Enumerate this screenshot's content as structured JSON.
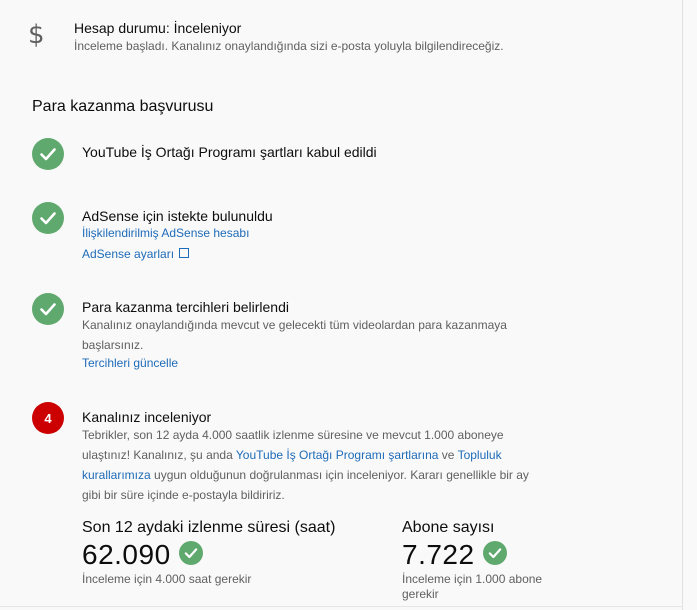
{
  "status": {
    "icon": "dollar-icon",
    "title": "Hesap durumu: İnceleniyor",
    "description": "İnceleme başladı. Kanalınız onaylandığında sizi e-posta yoluyla bilgilendireceğiz."
  },
  "monetization": {
    "title": "Para kazanma başvurusu",
    "steps": [
      {
        "state": "done",
        "title": "YouTube İş Ortağı Programı şartları kabul edildi"
      },
      {
        "state": "done",
        "title": "AdSense için istekte bulunuldu",
        "link1": "İlişkilendirilmiş AdSense hesabı",
        "link2": "AdSense ayarları"
      },
      {
        "state": "done",
        "title": "Para kazanma tercihleri belirlendi",
        "desc_line1": "Kanalınız onaylandığında mevcut ve gelecekti tüm videolardan para kazanmaya",
        "desc_line2": "başlarsınız.",
        "link": "Tercihleri güncelle"
      },
      {
        "state": "current",
        "number": "4",
        "title": "Kanalınız inceleniyor",
        "line1": "Tebrikler, son 12 ayda 4.000 saatlik izlenme süresine ve mevcut 1.000 aboneye",
        "line2_a": "ulaştınız! Kanalınız, şu anda ",
        "line2_link1": "YouTube İş Ortağı Programı şartlarına",
        "line2_b": " ve ",
        "line2_link2": "Topluluk",
        "line3_link": "kurallarımıza",
        "line3_b": " uygun olduğunun doğrulanması için inceleniyor. Kararı genellikle bir ay",
        "line4": "gibi bir süre içinde e-postayla bildiririz."
      }
    ]
  },
  "metrics": {
    "watch_time": {
      "label": "Son 12 aydaki izlenme süresi (saat)",
      "value": "62.090",
      "note": "İnceleme için 4.000 saat gerekir"
    },
    "subscribers": {
      "label": "Abone sayısı",
      "value": "7.722",
      "note_line1": "İnceleme için 1.000 abone",
      "note_line2": "gerekir"
    }
  },
  "colors": {
    "success": "#5fa96e",
    "current_step": "#cc0000",
    "link": "#1e6bb8"
  }
}
